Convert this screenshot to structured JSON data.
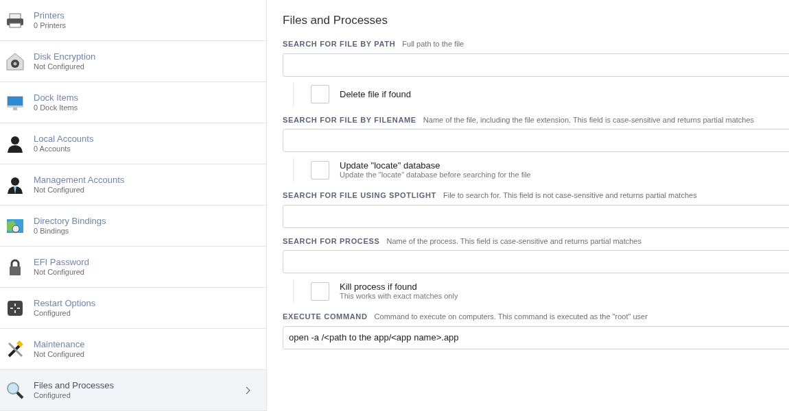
{
  "sidebar": {
    "items": [
      {
        "title": "Printers",
        "subtitle": "0 Printers",
        "selected": false
      },
      {
        "title": "Disk Encryption",
        "subtitle": "Not Configured",
        "selected": false
      },
      {
        "title": "Dock Items",
        "subtitle": "0 Dock Items",
        "selected": false
      },
      {
        "title": "Local Accounts",
        "subtitle": "0 Accounts",
        "selected": false
      },
      {
        "title": "Management Accounts",
        "subtitle": "Not Configured",
        "selected": false
      },
      {
        "title": "Directory Bindings",
        "subtitle": "0 Bindings",
        "selected": false
      },
      {
        "title": "EFI Password",
        "subtitle": "Not Configured",
        "selected": false
      },
      {
        "title": "Restart Options",
        "subtitle": "Configured",
        "selected": false
      },
      {
        "title": "Maintenance",
        "subtitle": "Not Configured",
        "selected": false
      },
      {
        "title": "Files and Processes",
        "subtitle": "Configured",
        "selected": true
      }
    ]
  },
  "main": {
    "title": "Files and Processes",
    "sections": [
      {
        "kind": "field",
        "label": "SEARCH FOR FILE BY PATH",
        "hint": "Full path to the file"
      },
      {
        "kind": "checkbox",
        "label": "Delete file if found",
        "checked": false
      },
      {
        "kind": "field",
        "label": "SEARCH FOR FILE BY FILENAME",
        "hint": "Name of the file, including the file extension. This field is case-sensitive and returns partial matches"
      },
      {
        "kind": "checkbox",
        "label": "Update \"locate\" database",
        "description": "Update the \"locate\" database before searching for the file",
        "checked": false
      },
      {
        "kind": "field",
        "label": "SEARCH FOR FILE USING SPOTLIGHT",
        "hint": "File to search for. This field is not case-sensitive and returns partial matches"
      },
      {
        "kind": "field",
        "label": "SEARCH FOR PROCESS",
        "hint": "Name of the process. This field is case-sensitive and returns partial matches"
      },
      {
        "kind": "checkbox",
        "label": "Kill process if found",
        "description": "This works with exact matches only",
        "checked": false
      },
      {
        "kind": "field",
        "label": "EXECUTE COMMAND",
        "hint": "Command to execute on computers. This command is executed as the \"root\" user",
        "value": "open -a /<path to the app/<app name>.app"
      }
    ]
  }
}
